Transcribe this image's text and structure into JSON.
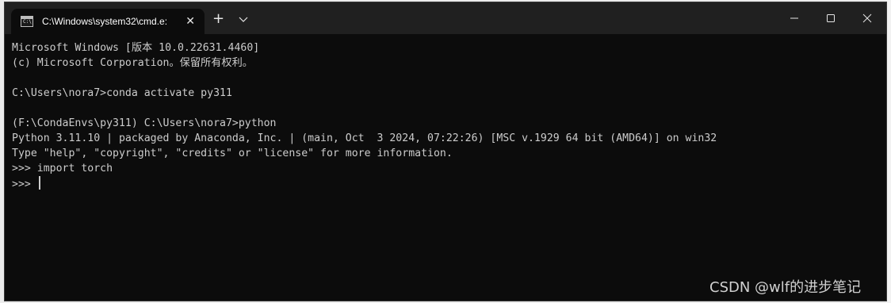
{
  "window": {
    "tab_title": "C:\\Windows\\system32\\cmd.e:",
    "tab_icon_text": "C:\\"
  },
  "terminal": {
    "lines": [
      "Microsoft Windows [版本 10.0.22631.4460]",
      "(c) Microsoft Corporation。保留所有权利。",
      "",
      "C:\\Users\\nora7>conda activate py311",
      "",
      "(F:\\CondaEnvs\\py311) C:\\Users\\nora7>python",
      "Python 3.11.10 | packaged by Anaconda, Inc. | (main, Oct  3 2024, 07:22:26) [MSC v.1929 64 bit (AMD64)] on win32",
      "Type \"help\", \"copyright\", \"credits\" or \"license\" for more information.",
      ">>> import torch"
    ],
    "prompt": ">>> "
  },
  "watermark": "CSDN @wlf的进步笔记",
  "colors": {
    "terminal_bg": "#0c0c0c",
    "titlebar_bg": "#202020",
    "text": "#cccccc"
  }
}
